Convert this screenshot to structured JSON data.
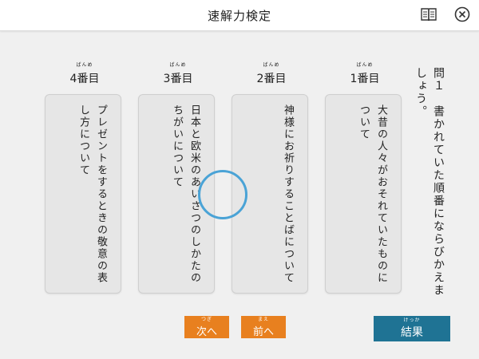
{
  "header": {
    "title": "速解力検定",
    "book_icon": "book-icon",
    "close_icon": "close-icon"
  },
  "question": {
    "text": "問１　書かれていた順番にならびかえましょう。"
  },
  "cards": [
    {
      "heading": "4番目",
      "heading_ruby": "ばんめ",
      "text": "プレゼントをするときの敬意の表し方について"
    },
    {
      "heading": "3番目",
      "heading_ruby": "ばんめ",
      "text": "日本と欧米のあいさつのしかたのちがいについて"
    },
    {
      "heading": "2番目",
      "heading_ruby": "ばんめ",
      "text": "神様にお祈りすることばについて"
    },
    {
      "heading": "1番目",
      "heading_ruby": "ばんめ",
      "text": "大昔の人々がおそれていたものについて"
    }
  ],
  "buttons": {
    "next_label": "次へ",
    "next_ruby": "つぎ",
    "prev_label": "前へ",
    "prev_ruby": "まえ",
    "result_label": "結果",
    "result_ruby": "けっか"
  },
  "colors": {
    "accent_orange": "#e8801f",
    "result_blue": "#1f7394",
    "circle_blue": "#4aa3d6"
  }
}
